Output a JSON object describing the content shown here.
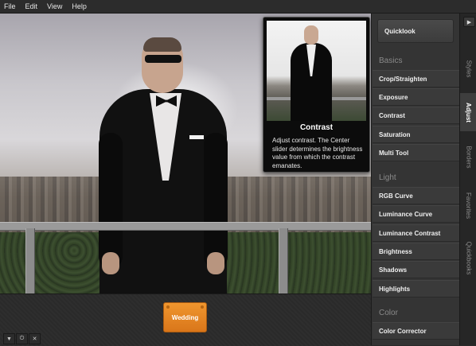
{
  "menu": {
    "items": [
      "File",
      "Edit",
      "View",
      "Help"
    ]
  },
  "tooltip": {
    "title": "Contrast",
    "text": "Adjust contrast. The Center slider determines the brightness value from which the contrast emanates."
  },
  "panel": {
    "quicklook": "Quicklook",
    "sections": [
      {
        "label": "Basics",
        "items": [
          "Crop/Straighten",
          "Exposure",
          "Contrast",
          "Saturation",
          "Multi Tool"
        ]
      },
      {
        "label": "Light",
        "items": [
          "RGB Curve",
          "Luminance Curve",
          "Luminance Contrast",
          "Brightness",
          "Shadows",
          "Highlights"
        ]
      },
      {
        "label": "Color",
        "items": [
          "Color Corrector"
        ]
      }
    ]
  },
  "tabs": {
    "arrow": "▶",
    "items": [
      "Styles",
      "Adjust",
      "Borders",
      "Favorites",
      "Quickbooks"
    ],
    "active": "Adjust"
  },
  "bottom": {
    "preset_label": "Wedding",
    "controls": [
      "▼",
      "⏻",
      "✕"
    ]
  },
  "colors": {
    "accent": "#e8882a",
    "panel_bg": "#343434",
    "item_bg": "#3a3a3a"
  }
}
